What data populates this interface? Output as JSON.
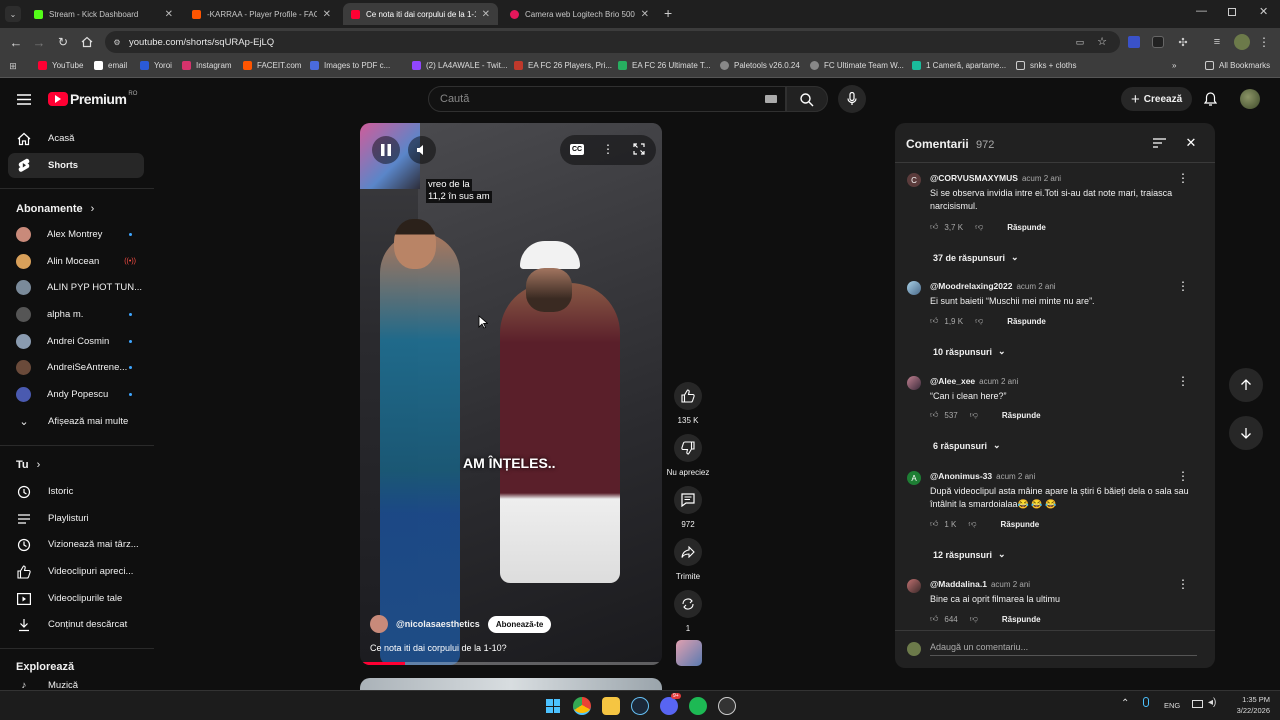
{
  "browser": {
    "tabs": [
      {
        "title": "Stream - Kick Dashboard",
        "color": "#53fc18"
      },
      {
        "title": "-KARRAA - Player Profile - FACEIT",
        "color": "#ff5500"
      },
      {
        "title": "Ce nota iti dai corpului de la 1-10?",
        "color": "#ff0033"
      },
      {
        "title": "Camera web Logitech Brio 500...",
        "color": "#e3175b"
      }
    ],
    "url": "youtube.com/shorts/sqURAp-EjLQ",
    "bookmarks": [
      "YouTube",
      "email",
      "Yoroi",
      "Instagram",
      "FACEIT.com",
      "Images to PDF c...",
      "(2) LA4AWALE - Twit...",
      "EA FC 26 Players, Pri...",
      "EA FC 26 Ultimate T...",
      "Paletools v26.0.24",
      "FC Ultimate Team W...",
      "1 Cameră, apartame...",
      "snks + cloths"
    ],
    "all_bookmarks": "All Bookmarks"
  },
  "yt": {
    "logo": "Premium",
    "region": "RO",
    "search_placeholder": "Caută",
    "create": "Creează",
    "nav": [
      "Acasă",
      "Shorts"
    ],
    "subs_heading": "Abonamente",
    "subs": [
      "Alex Montrey",
      "Alin Mocean",
      "ALIN PYP HOT TUN...",
      "alpha m.",
      "Andrei Cosmin",
      "AndreiSeAntrene...",
      "Andy Popescu"
    ],
    "show_more": "Afișează mai multe",
    "you_heading": "Tu",
    "you": [
      "Istoric",
      "Playlisturi",
      "Vizionează mai târz...",
      "Videoclipuri apreci...",
      "Videoclipurile tale",
      "Conținut descărcat"
    ],
    "explore_heading": "Explorează",
    "explore_partial": "Muzică"
  },
  "video": {
    "caption_top": [
      "vreo de la",
      "11,2 în sus am"
    ],
    "caption_mid": "AM ÎNȚELES..",
    "channel": "@nicolasaesthetics",
    "subscribe": "Abonează-te",
    "title": "Ce nota iti dai corpului de la 1-10?",
    "likes": "135 K",
    "dislike": "Nu apreciez",
    "comments": "972",
    "share": "Trimite",
    "remix": "1",
    "progress": 0.15
  },
  "comments": {
    "heading": "Comentarii",
    "count": "972",
    "items": [
      {
        "user": "@CORVUSMAXYMUS",
        "time": "acum 2 ani",
        "text": "Si se observa invidia intre ei.Toti si-au dat note mari, traiasca narcisismul.",
        "likes": "3,7 K",
        "reply": "Răspunde",
        "replies": "37 de răspunsuri",
        "av": "C",
        "avc": "#5a3b3b"
      },
      {
        "user": "@Moodrelaxing2022",
        "time": "acum 2 ani",
        "text": "Ei sunt baietii “Muschii mei minte nu are”.",
        "likes": "1,9 K",
        "reply": "Răspunde",
        "replies": "10 răspunsuri",
        "av": "",
        "avc": "#6b8aa3"
      },
      {
        "user": "@Alee_xee",
        "time": "acum 2 ani",
        "text": "“Can i clean here?”",
        "likes": "537",
        "reply": "Răspunde",
        "replies": "6 răspunsuri",
        "av": "",
        "avc": "#7b4b5a"
      },
      {
        "user": "@Anonimus-33",
        "time": "acum 2 ani",
        "text": "După videoclipul asta mâine apare la știri 6 băieți dela o sala sau întâlnit la smardoialaa😂 😂 😂",
        "likes": "1 K",
        "reply": "Răspunde",
        "replies": "12 răspunsuri",
        "av": "A",
        "avc": "#1e7e34"
      },
      {
        "user": "@Maddalina.1",
        "time": "acum 2 ani",
        "text": "Bine ca ai oprit filmarea la ultimu",
        "likes": "644",
        "reply": "Răspunde",
        "replies": "",
        "av": "",
        "avc": "#8a4a4a"
      }
    ],
    "add_placeholder": "Adaugă un comentariu..."
  },
  "taskbar": {
    "lang": "ENG",
    "time": "1:35 PM",
    "date": "3/22/2026",
    "discord_badge": "9+"
  }
}
